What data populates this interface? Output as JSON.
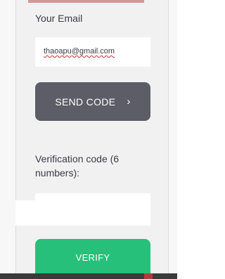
{
  "form": {
    "email_label": "Your Email",
    "email_value": "thaoapu@gmail.com",
    "send_code_label": "SEND CODE",
    "send_code_icon": "chevron-right-icon",
    "verification_label": "Verification code (6 numbers):",
    "verification_value": "",
    "verify_label": "VERIFY"
  },
  "colors": {
    "background": "#f1f1f2",
    "send_button": "#5d5d67",
    "verify_button": "#27c07a",
    "text": "#3b3b44"
  }
}
